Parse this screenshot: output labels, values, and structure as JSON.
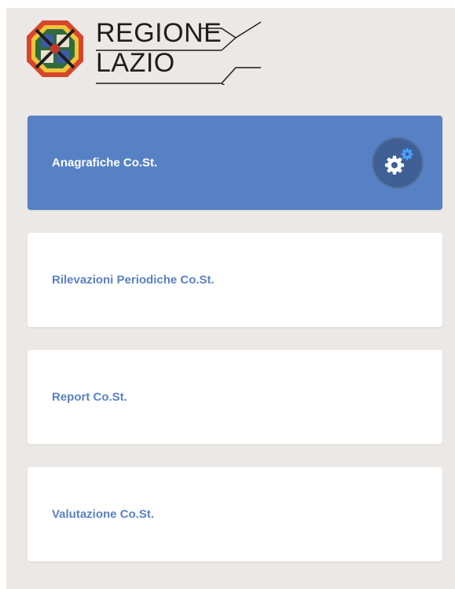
{
  "logo": {
    "line1": "REGIONE",
    "line2": "LAZIO",
    "emblem_icon": "regione-lazio-emblem-icon"
  },
  "menu": {
    "items": [
      {
        "label": "Anagrafiche Co.St.",
        "active": true,
        "icon": "gears-icon"
      },
      {
        "label": "Rilevazioni Periodiche Co.St.",
        "active": false
      },
      {
        "label": "Report Co.St.",
        "active": false
      },
      {
        "label": "Valutazione Co.St.",
        "active": false
      }
    ]
  },
  "colors": {
    "background": "#ebe8e6",
    "active_card": "#5681c4",
    "card_text": "#5a80c0",
    "badge": "#3f5f95",
    "gear_accent": "#4aa3ff"
  }
}
